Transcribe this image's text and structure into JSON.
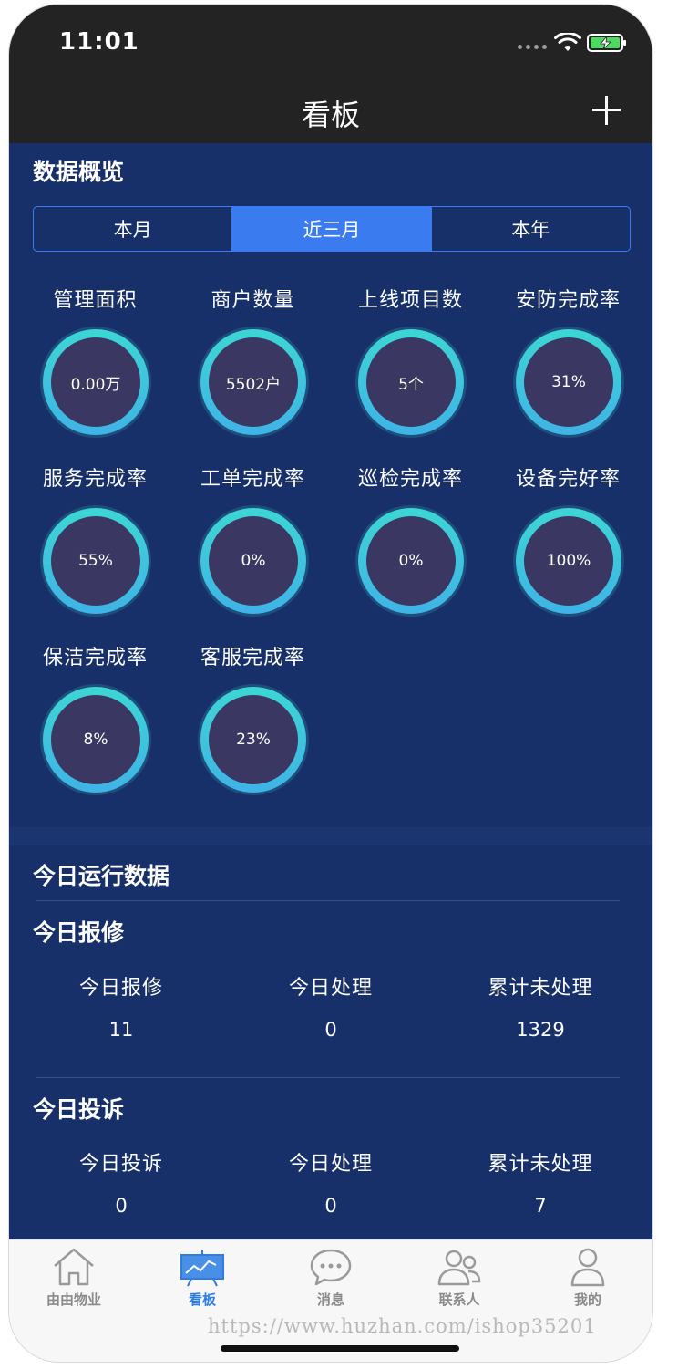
{
  "status_bar": {
    "time": "11:01"
  },
  "nav": {
    "title": "看板"
  },
  "overview": {
    "title": "数据概览",
    "segments": [
      "本月",
      "近三月",
      "本年"
    ],
    "selected_segment": "近三月",
    "metrics": [
      {
        "label": "管理面积",
        "value": "0.00万"
      },
      {
        "label": "商户数量",
        "value": "5502户"
      },
      {
        "label": "上线项目数",
        "value": "5个"
      },
      {
        "label": "安防完成率",
        "value": "31%"
      },
      {
        "label": "服务完成率",
        "value": "55%"
      },
      {
        "label": "工单完成率",
        "value": "0%"
      },
      {
        "label": "巡检完成率",
        "value": "0%"
      },
      {
        "label": "设备完好率",
        "value": "100%"
      },
      {
        "label": "保洁完成率",
        "value": "8%"
      },
      {
        "label": "客服完成率",
        "value": "23%"
      }
    ]
  },
  "today": {
    "title": "今日运行数据",
    "repair": {
      "title": "今日报修",
      "headers": [
        "今日报修",
        "今日处理",
        "累计未处理"
      ],
      "values": [
        "11",
        "0",
        "1329"
      ]
    },
    "complaint": {
      "title": "今日投诉",
      "headers": [
        "今日投诉",
        "今日处理",
        "累计未处理"
      ],
      "values": [
        "0",
        "0",
        "7"
      ]
    }
  },
  "tabbar": {
    "items": [
      {
        "label": "由由物业",
        "icon": "home-icon"
      },
      {
        "label": "看板",
        "icon": "chart-board-icon"
      },
      {
        "label": "消息",
        "icon": "message-icon"
      },
      {
        "label": "联系人",
        "icon": "contacts-icon"
      },
      {
        "label": "我的",
        "icon": "profile-icon"
      }
    ],
    "active": "看板"
  },
  "watermark": "https://www.huzhan.com/ishop35201",
  "colors": {
    "background": "#17306a",
    "accent": "#3a7bf0",
    "ring": "#3dd6d4",
    "ring_fill": "#3a3763"
  }
}
